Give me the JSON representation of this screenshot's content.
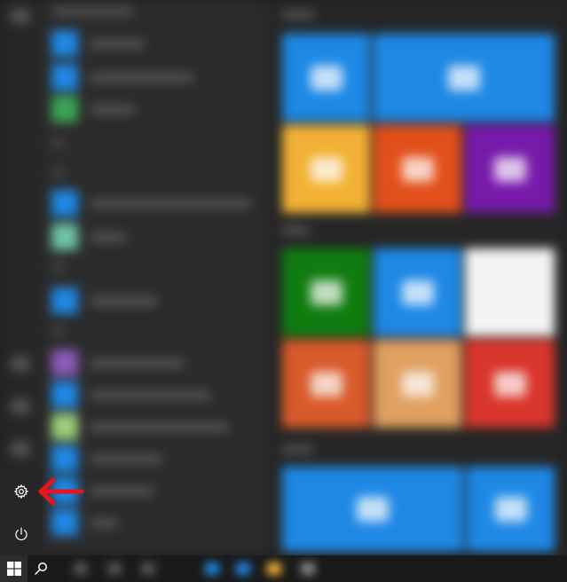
{
  "colors": {
    "accent": "#1e88e5",
    "arrow": "#e8141b",
    "rail_background": "#262626",
    "taskbar_background": "#1a1a1a"
  },
  "sidebar": {
    "settings_icon": "gear-icon",
    "power_icon": "power-icon"
  },
  "taskbar": {
    "start_icon": "windows-logo-icon",
    "search_icon": "search-icon"
  },
  "annotation": {
    "type": "arrow",
    "points_to": "settings",
    "icon": "left-arrow-icon"
  },
  "tiles": {
    "colors": [
      "#1e88e5",
      "#1e88e5",
      "#f2b134",
      "#e1501b",
      "#7719aa",
      "#107c10",
      "#1e88e5",
      "#f4f4f4",
      "#d85a2a",
      "#e0a060",
      "#d9352b",
      "#1e88e5",
      "#1e88e5"
    ]
  }
}
